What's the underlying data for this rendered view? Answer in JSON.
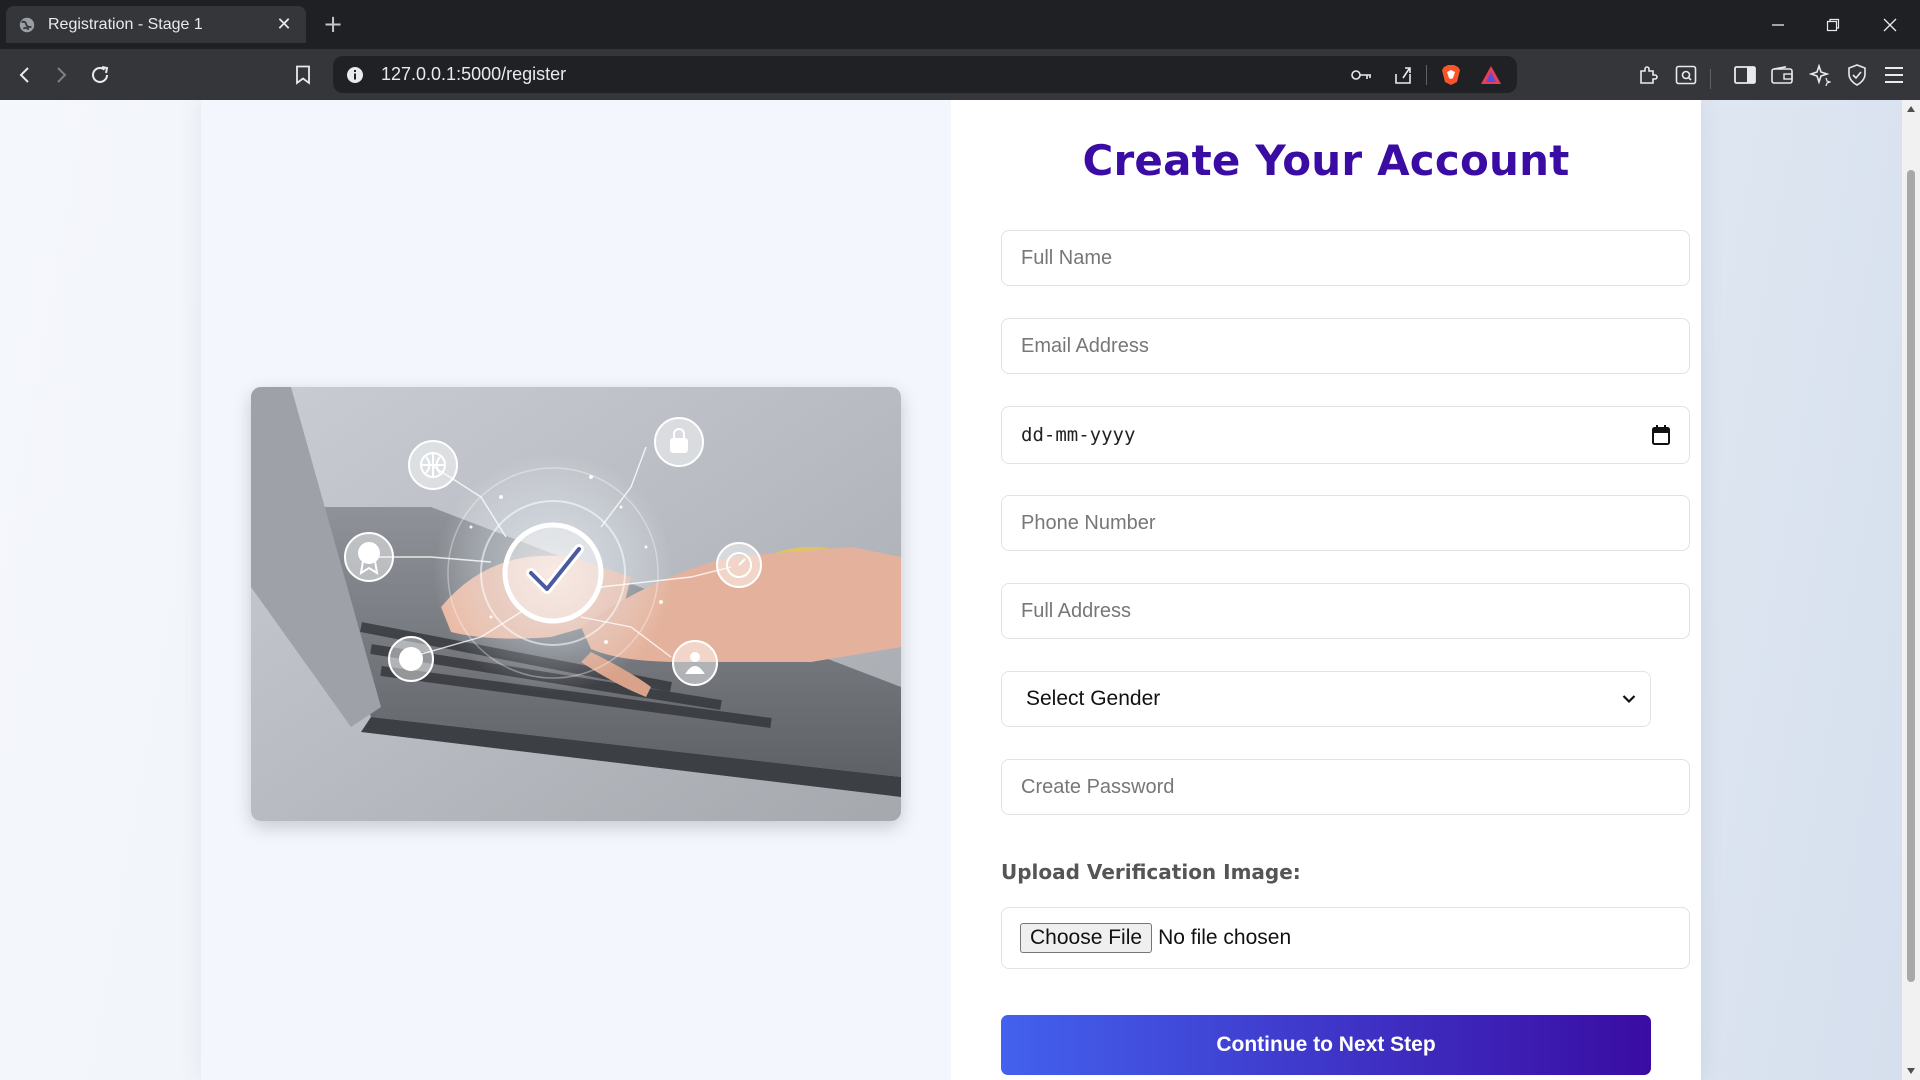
{
  "browser": {
    "tab_title": "Registration - Stage 1",
    "url": "127.0.0.1:5000/register"
  },
  "page": {
    "title": "Create Your Account",
    "fields": {
      "full_name_placeholder": "Full Name",
      "email_placeholder": "Email Address",
      "dob_placeholder": "dd-mm-yyyy",
      "phone_placeholder": "Phone Number",
      "address_placeholder": "Full Address",
      "gender_selected": "Select Gender",
      "password_placeholder": "Create Password"
    },
    "upload": {
      "label": "Upload Verification Image:",
      "button": "Choose File",
      "status": "No file chosen"
    },
    "submit_label": "Continue to Next Step",
    "hero_image": "laptop-with-security-checkmark-icons"
  },
  "colors": {
    "title": "#3a0ca3",
    "button_start": "#4361ee",
    "button_end": "#3a0ca3"
  }
}
